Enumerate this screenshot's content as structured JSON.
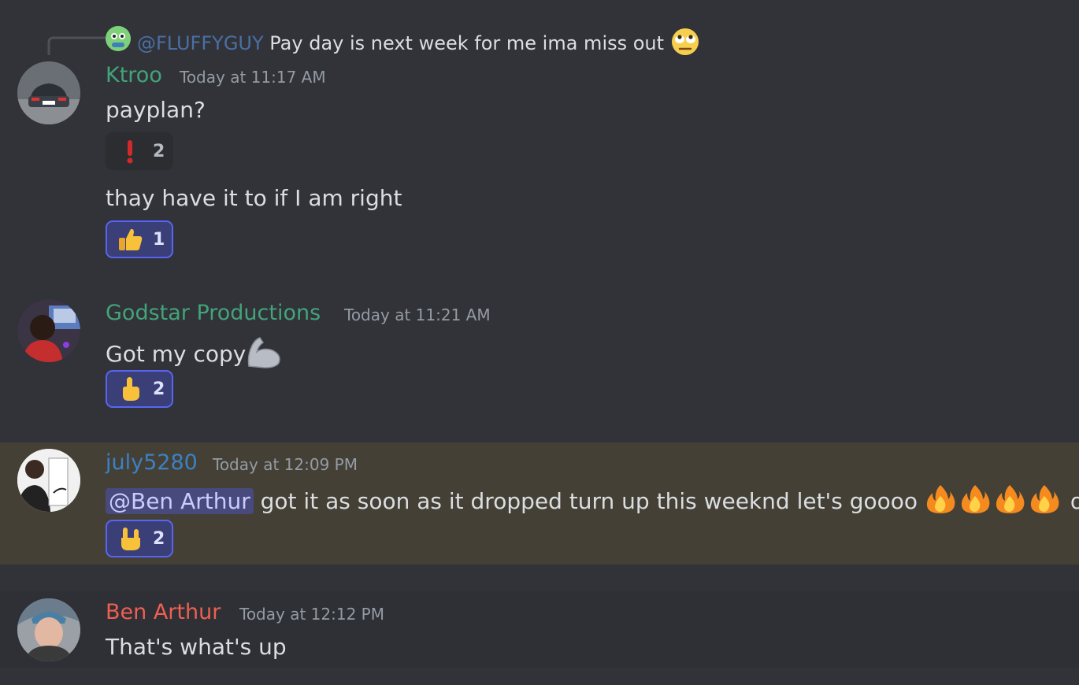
{
  "reply": {
    "mention": "@FLUFFYGUY",
    "text": "Pay day is next week for me ima miss out"
  },
  "messages": [
    {
      "username": "Ktroo",
      "timestamp": "Today at 11:17 AM",
      "color": "#43a37a",
      "lines": [
        {
          "text": "payplan?",
          "reaction": {
            "emoji": "exclamation-icon",
            "count": "2"
          }
        },
        {
          "text": "thay have it to if I am right",
          "reaction": {
            "emoji": "thumbs-up-icon",
            "count": "1"
          }
        }
      ]
    },
    {
      "username": "Godstar Productions",
      "timestamp": "Today at 11:21 AM",
      "color": "#43a37a",
      "text": "Got my copy",
      "reaction": {
        "emoji": "pointing-up-icon",
        "count": "2"
      }
    },
    {
      "username": "july5280",
      "timestamp": "Today at 12:09 PM",
      "color": "#3b81c4",
      "mention": "@Ben Arthur",
      "text": "got it as soon as it dropped turn up this weeknd let's goooo",
      "trailing": "o",
      "reaction": {
        "emoji": "rock-on-icon",
        "count": "2"
      }
    },
    {
      "username": "Ben Arthur",
      "timestamp": "Today at 12:12 PM",
      "color": "#ef5f52",
      "text": "That's what's up"
    }
  ]
}
